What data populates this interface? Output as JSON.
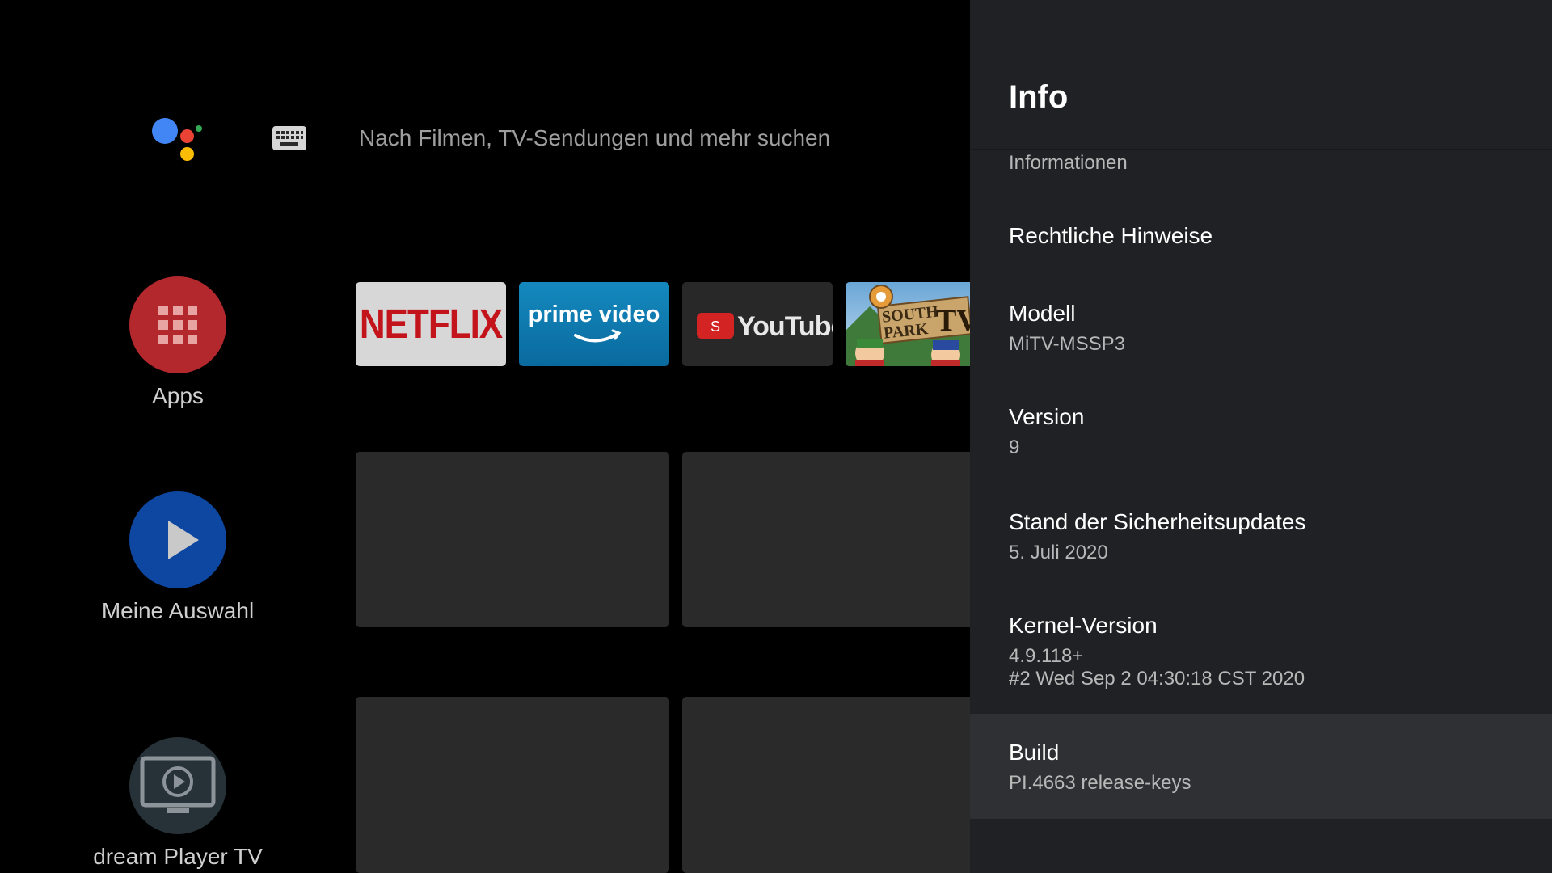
{
  "search": {
    "placeholder": "Nach Filmen, TV-Sendungen und mehr suchen"
  },
  "sidebar": {
    "items": [
      {
        "label": "Apps",
        "color": "#b3282d",
        "icon": "grid-icon"
      },
      {
        "label": "Meine Auswahl",
        "color": "#0d47a1",
        "icon": "play-icon"
      },
      {
        "label": "dream Player TV",
        "color": "#263238",
        "icon": "monitor-play-icon"
      }
    ]
  },
  "apps_row": [
    {
      "label": "NETFLIX",
      "bg": "#d7d7d7",
      "color": "#c4141b"
    },
    {
      "label": "prime video",
      "bg": "#0f7cb0",
      "color": "#ffffff"
    },
    {
      "label": "YouTube",
      "bg": "#282828",
      "color": "#ffffff"
    },
    {
      "label": "SOUTH PARK",
      "label2": "TV",
      "bg": "#6aa6d6",
      "color": "#3a2a14"
    }
  ],
  "panel": {
    "title": "Info",
    "partial_item": "Informationen",
    "items": [
      {
        "title": "Rechtliche Hinweise"
      },
      {
        "title": "Modell",
        "value": "MiTV-MSSP3"
      },
      {
        "title": "Version",
        "value": "9"
      },
      {
        "title": "Stand der Sicherheitsupdates",
        "value": "5. Juli 2020"
      },
      {
        "title": "Kernel-Version",
        "value": "4.9.118+",
        "value2": "#2 Wed Sep 2 04:30:18 CST 2020"
      },
      {
        "title": "Build",
        "value": "PI.4663 release-keys"
      }
    ]
  },
  "colors": {
    "background": "#000000",
    "panel": "#202124",
    "selected_row": "#2f3033",
    "card": "#2a2a2a"
  }
}
